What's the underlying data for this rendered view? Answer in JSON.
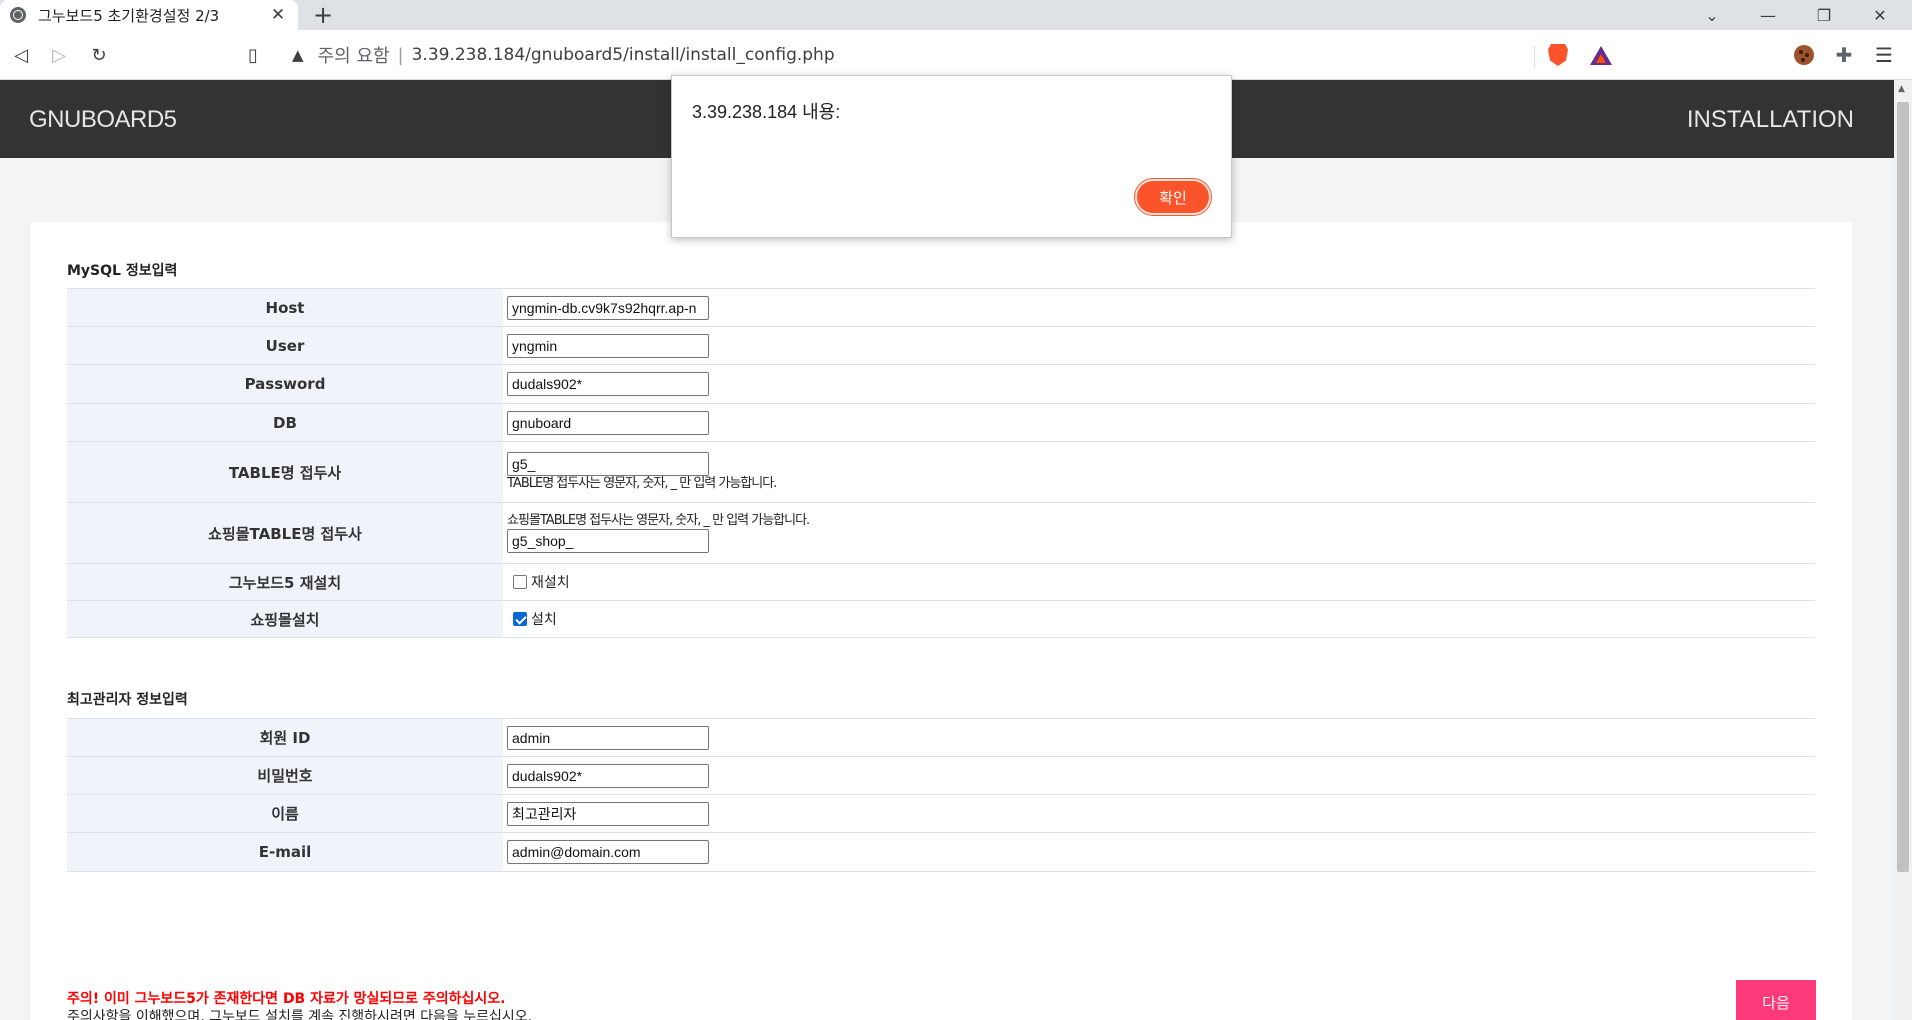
{
  "browser": {
    "tab_title": "그누보드5 초기환경설정 2/3",
    "tab_close": "✕",
    "new_tab": "+",
    "security_warning": "주의 요함",
    "url_separator": "|",
    "url": "3.39.238.184/gnuboard5/install/install_config.php"
  },
  "header": {
    "brand": "GNUBOARD5",
    "right_label": "INSTALLATION"
  },
  "mysql": {
    "title": "MySQL 정보입력",
    "rows": {
      "host": {
        "label": "Host",
        "value": "yngmin-db.cv9k7s92hqrr.ap-n"
      },
      "user": {
        "label": "User",
        "value": "yngmin"
      },
      "password": {
        "label": "Password",
        "value": "dudals902*"
      },
      "db": {
        "label": "DB",
        "value": "gnuboard"
      },
      "table_prefix": {
        "label": "TABLE명 접두사",
        "value": "g5_",
        "help": "TABLE명 접두사는 영문자, 숫자, _ 만 입력 가능합니다."
      },
      "shop_prefix": {
        "label": "쇼핑몰TABLE명 접두사",
        "value": "g5_shop_",
        "help": "쇼핑몰TABLE명 접두사는 영문자, 숫자, _ 만 입력 가능합니다."
      },
      "reinstall": {
        "label": "그누보드5 재설치",
        "checkbox_label": "재설치",
        "checked": false
      },
      "shop_install": {
        "label": "쇼핑몰설치",
        "checkbox_label": "설치",
        "checked": true
      }
    }
  },
  "admin": {
    "title": "최고관리자 정보입력",
    "rows": {
      "member_id": {
        "label": "회원 ID",
        "value": "admin"
      },
      "password": {
        "label": "비밀번호",
        "value": "dudals902*"
      },
      "name": {
        "label": "이름",
        "value": "최고관리자"
      },
      "email": {
        "label": "E-mail",
        "value": "admin@domain.com"
      }
    }
  },
  "notice": {
    "warning": "주의! 이미 그누보드5가 존재한다면 DB 자료가 망실되므로 주의하십시오.",
    "instruction": "주의사항을 이해했으며, 그누보드 설치를 계속 진행하시려면 다음을 누르십시오."
  },
  "next_button": "다음",
  "alert": {
    "title": "3.39.238.184 내용:",
    "ok_button": "확인"
  },
  "colors": {
    "header_bg": "#333333",
    "warning_red": "#ff0000",
    "next_button_bg": "#ff3a7a",
    "alert_ok_bg": "#fb542b"
  },
  "icons": {
    "favicon": "globe-icon",
    "back": "back-arrow-icon",
    "forward": "forward-arrow-icon",
    "reload": "reload-icon",
    "bookmark": "bookmark-icon",
    "warning": "warning-triangle-icon",
    "brave": "brave-shield-icon",
    "rewards": "brave-rewards-icon",
    "cookie": "cookie-icon",
    "extensions": "puzzle-icon",
    "menu": "menu-icon"
  }
}
